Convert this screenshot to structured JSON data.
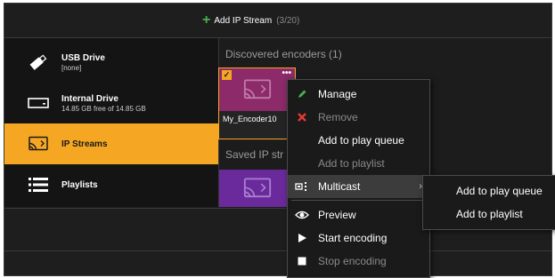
{
  "header": {
    "add_label": "Add IP Stream",
    "count": "(3/20)"
  },
  "sidebar": {
    "items": [
      {
        "label": "USB Drive",
        "sub": "[none]"
      },
      {
        "label": "Internal Drive",
        "sub": "14.85 GB free of 14.85 GB"
      },
      {
        "label": "IP Streams",
        "sub": ""
      },
      {
        "label": "Playlists",
        "sub": ""
      }
    ]
  },
  "main": {
    "discovered_title": "Discovered encoders  (1)",
    "saved_title": "Saved IP str",
    "encoder_name": "My_Encoder10",
    "more_glyph": "•••",
    "check_glyph": "✓"
  },
  "context_menu": {
    "items": [
      {
        "label": "Manage",
        "icon": "pencil-icon",
        "enabled": true
      },
      {
        "label": "Remove",
        "icon": "x-icon",
        "enabled": false
      },
      {
        "label": "Add to play queue",
        "icon": "",
        "enabled": true
      },
      {
        "label": "Add to playlist",
        "icon": "",
        "enabled": false
      },
      {
        "label": "Multicast",
        "icon": "multicast-icon",
        "enabled": true,
        "submenu": true
      },
      {
        "label": "Preview",
        "icon": "eye-icon",
        "enabled": true
      },
      {
        "label": "Start encoding",
        "icon": "play-icon",
        "enabled": true
      },
      {
        "label": "Stop encoding",
        "icon": "stop-icon",
        "enabled": false
      }
    ],
    "submenu_arrow": "›"
  },
  "submenu": {
    "items": [
      {
        "label": "Add to play queue"
      },
      {
        "label": "Add to playlist"
      }
    ]
  },
  "colors": {
    "accent": "#f5a623",
    "manage_icon": "#4caf50",
    "remove_icon": "#e53935",
    "tile_magenta": "#8c2a6a",
    "tile_purple": "#6a2a9c"
  }
}
